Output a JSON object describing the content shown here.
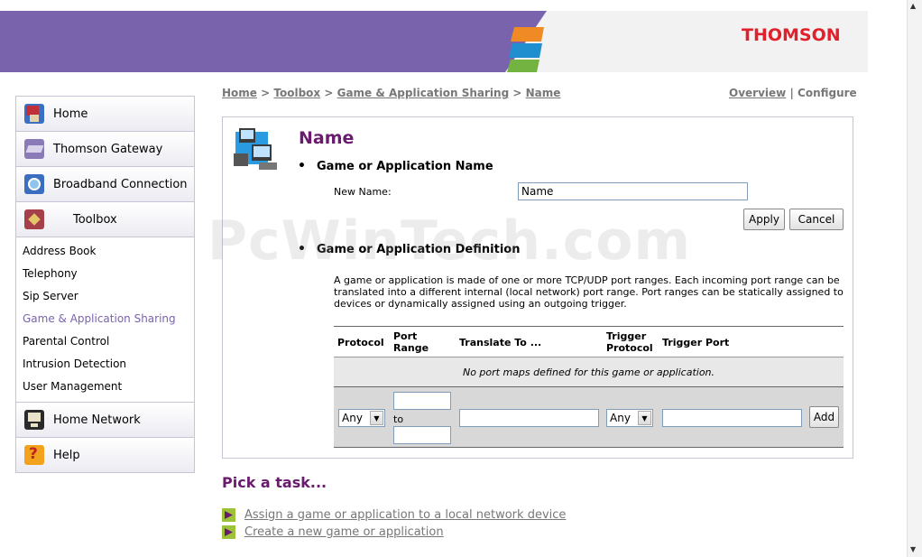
{
  "header": {
    "brand": "THOMSON",
    "stripe_colors": [
      "#f08a24",
      "#1f8fd0",
      "#72b342"
    ]
  },
  "colors": {
    "accent_purple": "#7a63ad",
    "title_purple": "#6a1b6e",
    "brand_red": "#e0202a"
  },
  "sidebar": {
    "items": [
      {
        "label": "Home",
        "icon": "home-icon"
      },
      {
        "label": "Thomson Gateway",
        "icon": "gateway-icon"
      },
      {
        "label": "Broadband Connection",
        "icon": "broadband-icon"
      },
      {
        "label": "Toolbox",
        "icon": "toolbox-icon"
      }
    ],
    "subitems": [
      "Address Book",
      "Telephony",
      "Sip Server",
      "Game & Application Sharing",
      "Parental Control",
      "Intrusion Detection",
      "User Management"
    ],
    "active_subitem": "Game & Application Sharing",
    "items_after": [
      {
        "label": "Home Network",
        "icon": "home-network-icon"
      },
      {
        "label": "Help",
        "icon": "help-icon"
      }
    ]
  },
  "breadcrumb": {
    "home": "Home",
    "toolbox": "Toolbox",
    "game_sharing": "Game & Application Sharing",
    "name": "Name",
    "sep": ">"
  },
  "topright": {
    "overview": "Overview",
    "sep": "|",
    "configure": "Configure"
  },
  "panel": {
    "title": "Name",
    "section1_heading": "Game or Application Name",
    "new_name_label": "New Name:",
    "new_name_value": "Name",
    "apply_label": "Apply",
    "cancel_label": "Cancel",
    "section2_heading": "Game or Application Definition",
    "description": "A game or application is made of one or more TCP/UDP port ranges. Each incoming port range can be translated into a different internal (local network) port range. Port ranges can be statically assigned to devices or dynamically assigned using an outgoing trigger.",
    "table": {
      "headers": {
        "protocol": "Protocol",
        "port_range": "Port Range",
        "translate_to": "Translate To ...",
        "trigger_protocol": "Trigger Protocol",
        "trigger_port": "Trigger Port"
      },
      "empty_message": "No port maps defined for this game or application.",
      "protocol_selected": "Any",
      "to_label": "to",
      "trigger_protocol_selected": "Any",
      "add_label": "Add"
    }
  },
  "watermark": "PcWinTech.com",
  "tasks": {
    "title": "Pick a task...",
    "items": [
      "Assign a game or application to a local network device",
      "Create a new game or application"
    ]
  }
}
